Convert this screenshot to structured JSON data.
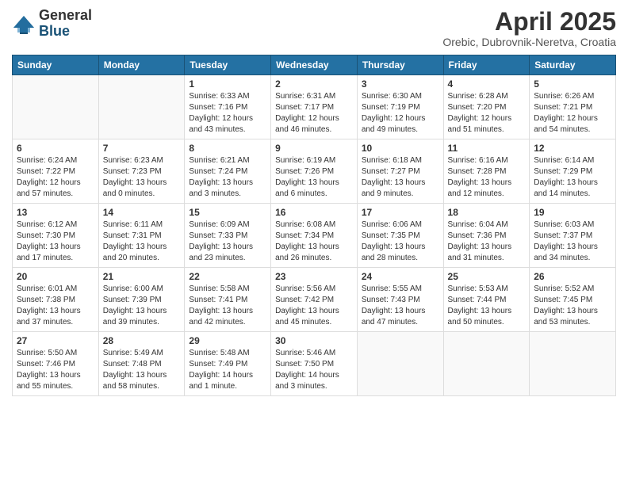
{
  "header": {
    "logo_general": "General",
    "logo_blue": "Blue",
    "month_title": "April 2025",
    "location": "Orebic, Dubrovnik-Neretva, Croatia"
  },
  "weekdays": [
    "Sunday",
    "Monday",
    "Tuesday",
    "Wednesday",
    "Thursday",
    "Friday",
    "Saturday"
  ],
  "days": {
    "1": {
      "sunrise": "6:33 AM",
      "sunset": "7:16 PM",
      "daylight": "12 hours and 43 minutes."
    },
    "2": {
      "sunrise": "6:31 AM",
      "sunset": "7:17 PM",
      "daylight": "12 hours and 46 minutes."
    },
    "3": {
      "sunrise": "6:30 AM",
      "sunset": "7:19 PM",
      "daylight": "12 hours and 49 minutes."
    },
    "4": {
      "sunrise": "6:28 AM",
      "sunset": "7:20 PM",
      "daylight": "12 hours and 51 minutes."
    },
    "5": {
      "sunrise": "6:26 AM",
      "sunset": "7:21 PM",
      "daylight": "12 hours and 54 minutes."
    },
    "6": {
      "sunrise": "6:24 AM",
      "sunset": "7:22 PM",
      "daylight": "12 hours and 57 minutes."
    },
    "7": {
      "sunrise": "6:23 AM",
      "sunset": "7:23 PM",
      "daylight": "13 hours and 0 minutes."
    },
    "8": {
      "sunrise": "6:21 AM",
      "sunset": "7:24 PM",
      "daylight": "13 hours and 3 minutes."
    },
    "9": {
      "sunrise": "6:19 AM",
      "sunset": "7:26 PM",
      "daylight": "13 hours and 6 minutes."
    },
    "10": {
      "sunrise": "6:18 AM",
      "sunset": "7:27 PM",
      "daylight": "13 hours and 9 minutes."
    },
    "11": {
      "sunrise": "6:16 AM",
      "sunset": "7:28 PM",
      "daylight": "13 hours and 12 minutes."
    },
    "12": {
      "sunrise": "6:14 AM",
      "sunset": "7:29 PM",
      "daylight": "13 hours and 14 minutes."
    },
    "13": {
      "sunrise": "6:12 AM",
      "sunset": "7:30 PM",
      "daylight": "13 hours and 17 minutes."
    },
    "14": {
      "sunrise": "6:11 AM",
      "sunset": "7:31 PM",
      "daylight": "13 hours and 20 minutes."
    },
    "15": {
      "sunrise": "6:09 AM",
      "sunset": "7:33 PM",
      "daylight": "13 hours and 23 minutes."
    },
    "16": {
      "sunrise": "6:08 AM",
      "sunset": "7:34 PM",
      "daylight": "13 hours and 26 minutes."
    },
    "17": {
      "sunrise": "6:06 AM",
      "sunset": "7:35 PM",
      "daylight": "13 hours and 28 minutes."
    },
    "18": {
      "sunrise": "6:04 AM",
      "sunset": "7:36 PM",
      "daylight": "13 hours and 31 minutes."
    },
    "19": {
      "sunrise": "6:03 AM",
      "sunset": "7:37 PM",
      "daylight": "13 hours and 34 minutes."
    },
    "20": {
      "sunrise": "6:01 AM",
      "sunset": "7:38 PM",
      "daylight": "13 hours and 37 minutes."
    },
    "21": {
      "sunrise": "6:00 AM",
      "sunset": "7:39 PM",
      "daylight": "13 hours and 39 minutes."
    },
    "22": {
      "sunrise": "5:58 AM",
      "sunset": "7:41 PM",
      "daylight": "13 hours and 42 minutes."
    },
    "23": {
      "sunrise": "5:56 AM",
      "sunset": "7:42 PM",
      "daylight": "13 hours and 45 minutes."
    },
    "24": {
      "sunrise": "5:55 AM",
      "sunset": "7:43 PM",
      "daylight": "13 hours and 47 minutes."
    },
    "25": {
      "sunrise": "5:53 AM",
      "sunset": "7:44 PM",
      "daylight": "13 hours and 50 minutes."
    },
    "26": {
      "sunrise": "5:52 AM",
      "sunset": "7:45 PM",
      "daylight": "13 hours and 53 minutes."
    },
    "27": {
      "sunrise": "5:50 AM",
      "sunset": "7:46 PM",
      "daylight": "13 hours and 55 minutes."
    },
    "28": {
      "sunrise": "5:49 AM",
      "sunset": "7:48 PM",
      "daylight": "13 hours and 58 minutes."
    },
    "29": {
      "sunrise": "5:48 AM",
      "sunset": "7:49 PM",
      "daylight": "14 hours and 1 minute."
    },
    "30": {
      "sunrise": "5:46 AM",
      "sunset": "7:50 PM",
      "daylight": "14 hours and 3 minutes."
    }
  }
}
